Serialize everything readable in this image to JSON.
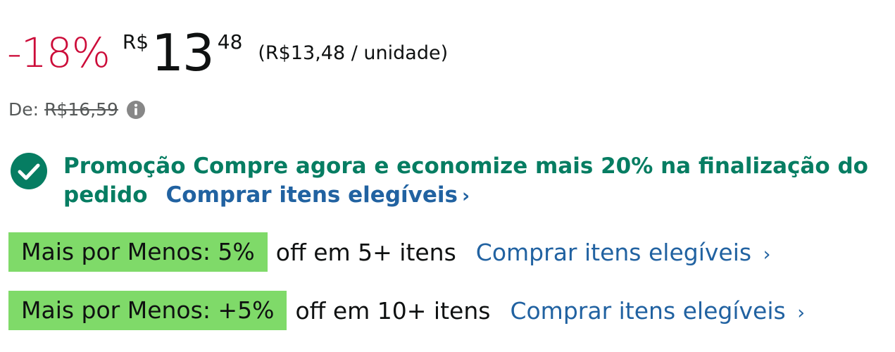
{
  "price": {
    "discount": "-18%",
    "currency_symbol": "R$",
    "whole": "13",
    "fraction": "48",
    "per_unit": "(R$13,48 / unidade)"
  },
  "list_price": {
    "label": "De:",
    "value": "R$16,59",
    "info_icon": "info-icon"
  },
  "promotion": {
    "icon": "check-circle-icon",
    "text": "Promoção Compre agora e economize mais 20% na finalização do pedido",
    "link": "Comprar itens elegíveis",
    "chevron": "›"
  },
  "tiers": [
    {
      "badge": "Mais por Menos: 5%",
      "description": "off em 5+ itens",
      "link": "Comprar itens elegíveis",
      "chevron": "›"
    },
    {
      "badge": "Mais por Menos: +5%",
      "description": "off em 10+ itens",
      "link": "Comprar itens elegíveis",
      "chevron": "›"
    }
  ],
  "colors": {
    "discount": "#cc0c39",
    "promo_green": "#067d62",
    "link_blue": "#2162a1",
    "badge_green": "#7fda69"
  }
}
